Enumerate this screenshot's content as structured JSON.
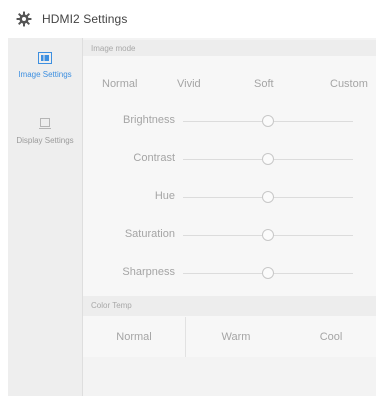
{
  "window": {
    "title": "HDMI2 Settings"
  },
  "sidebar": {
    "items": [
      {
        "label": "Image Settings",
        "icon": "image-settings-icon",
        "active": true
      },
      {
        "label": "Display Settings",
        "icon": "display-settings-icon",
        "active": false
      }
    ]
  },
  "image_mode": {
    "section_label": "Image mode",
    "options": [
      "Normal",
      "Vivid",
      "Soft",
      "Custom"
    ],
    "selected": "Normal"
  },
  "adjustments": [
    {
      "label": "Brightness",
      "value": 0.5
    },
    {
      "label": "Contrast",
      "value": 0.5
    },
    {
      "label": "Hue",
      "value": 0.5
    },
    {
      "label": "Saturation",
      "value": 0.5
    },
    {
      "label": "Sharpness",
      "value": 0.5
    }
  ],
  "color_temp": {
    "section_label": "Color Temp",
    "options": [
      "Normal",
      "Warm",
      "Cool"
    ],
    "selected": "Normal"
  },
  "colors": {
    "accent": "#2f86e3",
    "sidebar_bg": "#eeeeee",
    "panel_bg": "#f7f7f7"
  }
}
